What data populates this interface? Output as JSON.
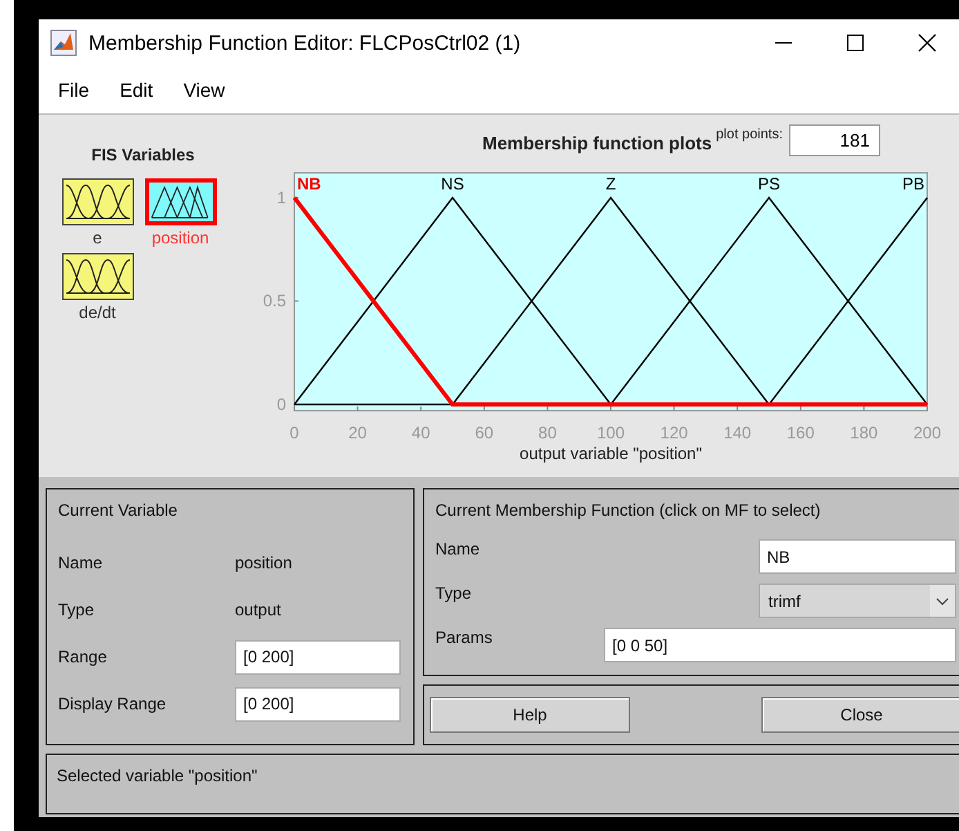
{
  "window": {
    "title": "Membership Function Editor: FLCPosCtrl02 (1)"
  },
  "menu": [
    "File",
    "Edit",
    "View"
  ],
  "fis_variables": {
    "title": "FIS Variables",
    "items": [
      {
        "name": "e",
        "kind": "input",
        "selected": false
      },
      {
        "name": "position",
        "kind": "output",
        "selected": true
      },
      {
        "name": "de/dt",
        "kind": "input",
        "selected": false
      }
    ]
  },
  "plot": {
    "title": "Membership function plots",
    "plot_points_label": "plot points:",
    "plot_points": "181",
    "chart_data": {
      "type": "line",
      "xlabel": "output variable \"position\"",
      "x": [
        0,
        50,
        100,
        150,
        200
      ],
      "series": [
        {
          "name": "NB",
          "color": "#ff0000",
          "values": [
            1,
            0,
            0,
            0,
            0
          ]
        },
        {
          "name": "NS",
          "color": "#000000",
          "values": [
            0,
            1,
            0,
            null,
            null
          ]
        },
        {
          "name": "Z",
          "color": "#000000",
          "values": [
            null,
            0,
            1,
            0,
            null
          ]
        },
        {
          "name": "PS",
          "color": "#000000",
          "values": [
            null,
            null,
            0,
            1,
            0
          ]
        },
        {
          "name": "PB",
          "color": "#000000",
          "values": [
            null,
            null,
            null,
            0,
            1
          ]
        }
      ],
      "xlim": [
        0,
        200
      ],
      "xticks": [
        0,
        20,
        40,
        60,
        80,
        100,
        120,
        140,
        160,
        180,
        200
      ],
      "ylim": [
        -0.03,
        1.12
      ],
      "yticks": [
        0,
        0.5,
        1
      ]
    }
  },
  "current_variable": {
    "title": "Current Variable",
    "rows": [
      {
        "label": "Name",
        "value": "position",
        "kind": "text"
      },
      {
        "label": "Type",
        "value": "output",
        "kind": "text"
      },
      {
        "label": "Range",
        "value": "[0 200]",
        "kind": "field"
      },
      {
        "label": "Display Range",
        "value": "[0 200]",
        "kind": "field"
      }
    ]
  },
  "current_mf": {
    "title": "Current Membership Function (click on MF to select)",
    "rows": [
      {
        "label": "Name",
        "value": "NB",
        "kind": "field"
      },
      {
        "label": "Type",
        "value": "trimf",
        "kind": "dropdown"
      },
      {
        "label": "Params",
        "value": "[0 0 50]",
        "kind": "wide_field"
      }
    ]
  },
  "buttons": [
    "Help",
    "Close"
  ],
  "status": "Selected variable \"position\""
}
